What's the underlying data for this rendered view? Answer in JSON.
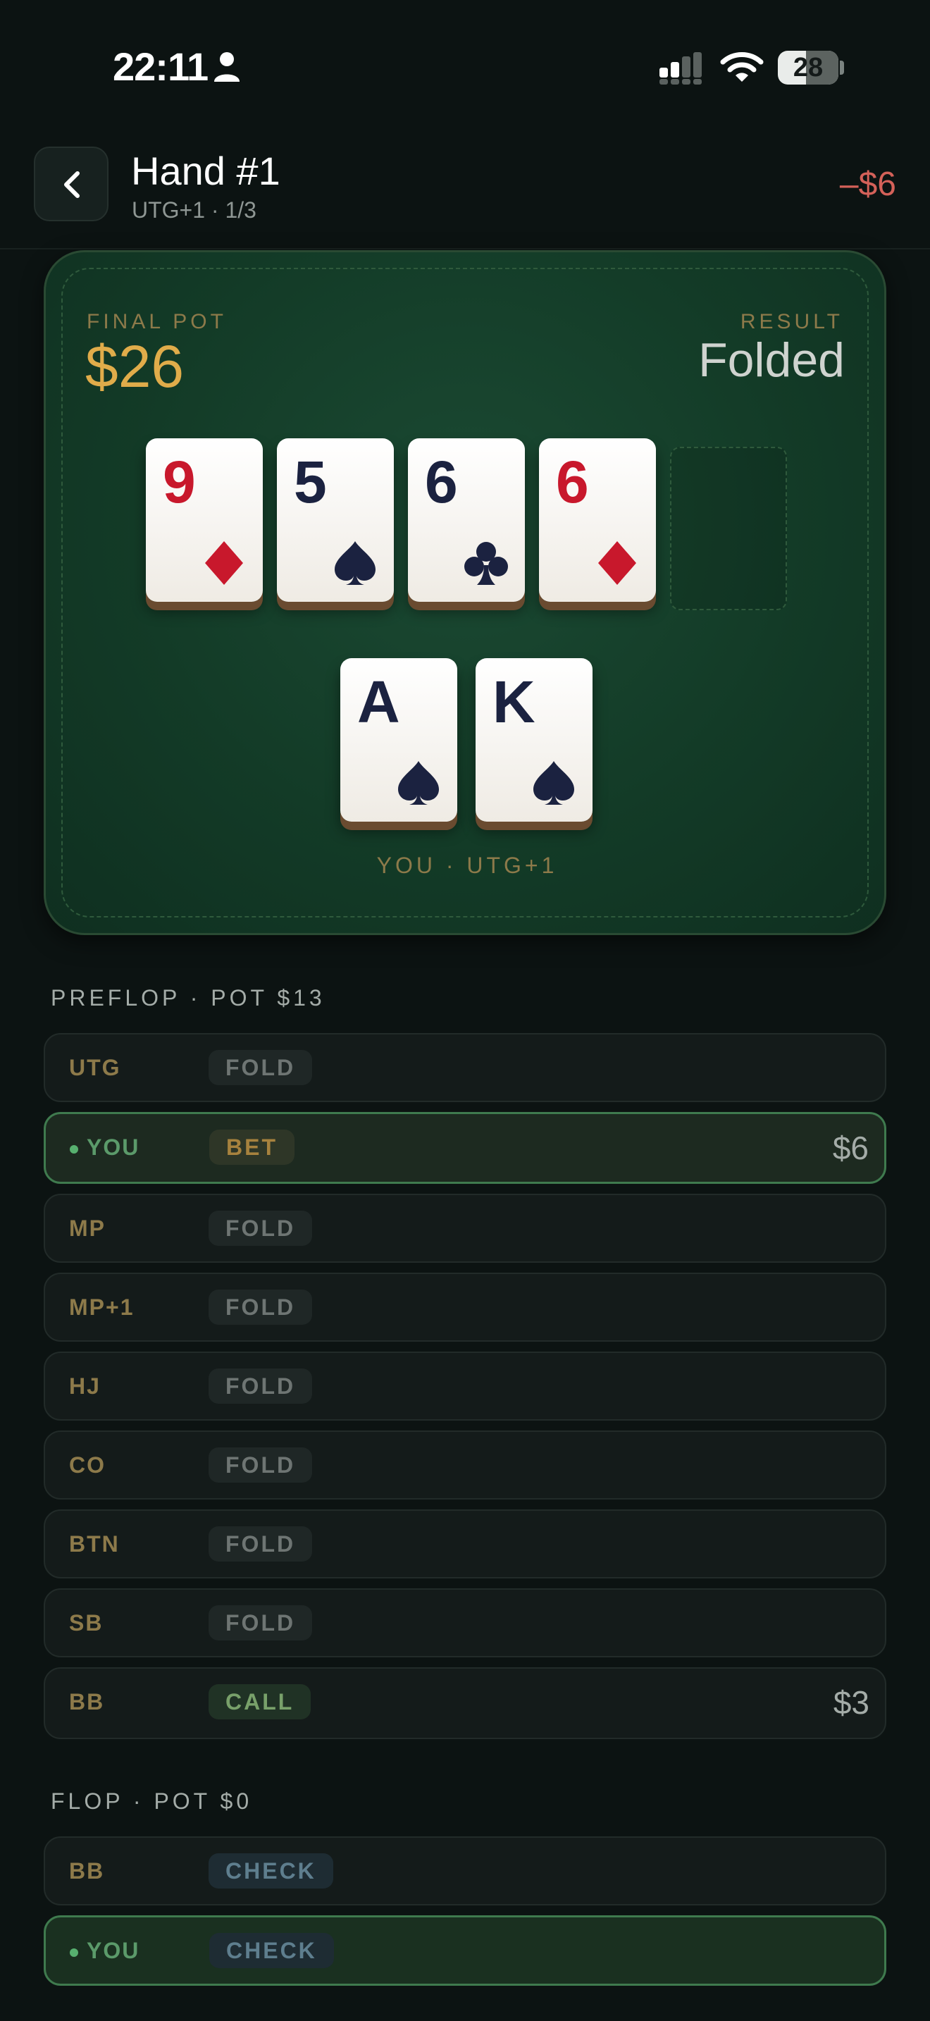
{
  "status": {
    "time": "22:11",
    "battery": "28"
  },
  "header": {
    "title": "Hand #1",
    "subtitle": "UTG+1 · 1/3",
    "result": "–$6"
  },
  "table": {
    "pot_label": "FINAL POT",
    "pot_value": "$26",
    "result_label": "RESULT",
    "result_value": "Folded",
    "board": [
      {
        "rank": "9",
        "suit": "diamond",
        "color": "#c8182c"
      },
      {
        "rank": "5",
        "suit": "spade",
        "color": "#1b2240"
      },
      {
        "rank": "6",
        "suit": "club",
        "color": "#1b2240"
      },
      {
        "rank": "6",
        "suit": "diamond",
        "color": "#c8182c"
      }
    ],
    "hole": [
      {
        "rank": "A",
        "suit": "spade",
        "color": "#1b2240"
      },
      {
        "rank": "K",
        "suit": "spade",
        "color": "#1b2240"
      }
    ],
    "player_label": "YOU · UTG+1"
  },
  "preflop": {
    "title": "PREFLOP · POT $13",
    "actions": [
      {
        "pos": "UTG",
        "action": "FOLD",
        "amount": ""
      },
      {
        "pos": "YOU",
        "action": "BET",
        "amount": "$6"
      },
      {
        "pos": "MP",
        "action": "FOLD",
        "amount": ""
      },
      {
        "pos": "MP+1",
        "action": "FOLD",
        "amount": ""
      },
      {
        "pos": "HJ",
        "action": "FOLD",
        "amount": ""
      },
      {
        "pos": "CO",
        "action": "FOLD",
        "amount": ""
      },
      {
        "pos": "BTN",
        "action": "FOLD",
        "amount": ""
      },
      {
        "pos": "SB",
        "action": "FOLD",
        "amount": ""
      },
      {
        "pos": "BB",
        "action": "CALL",
        "amount": "$3"
      }
    ]
  },
  "flop": {
    "title": "FLOP · POT $0",
    "actions": [
      {
        "pos": "BB",
        "action": "CHECK",
        "amount": ""
      },
      {
        "pos": "YOU",
        "action": "CHECK",
        "amount": ""
      }
    ]
  },
  "colors": {
    "accent_gold": "#e0ac4a",
    "loss_red": "#d46159",
    "you_green": "#3f7a4e"
  }
}
